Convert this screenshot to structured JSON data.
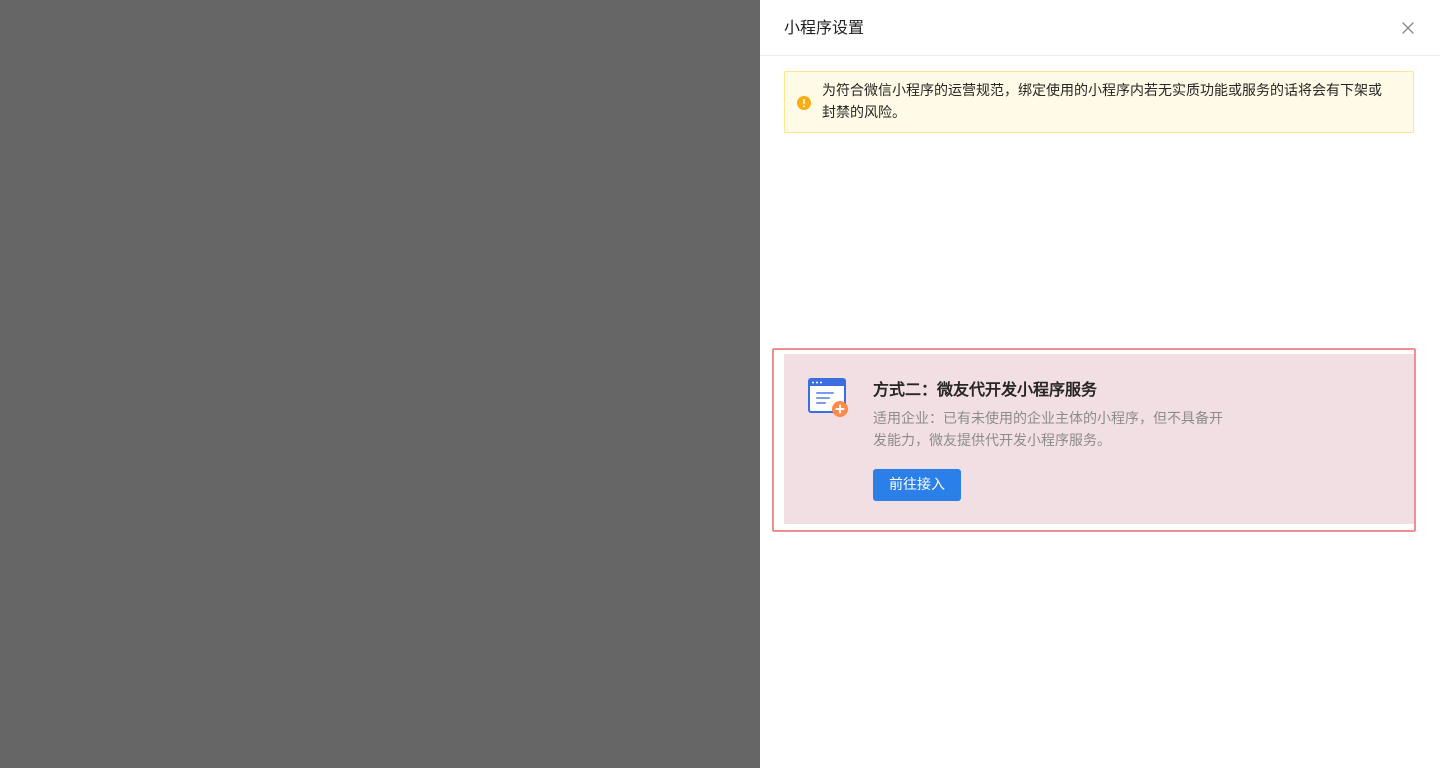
{
  "drawer": {
    "title": "小程序设置",
    "close_icon": "close-icon"
  },
  "alert": {
    "icon": "exclamation-circle-icon",
    "color": "#faad14",
    "text": "为符合微信小程序的运营规范，绑定使用的小程序内若无实质功能或服务的话将会有下架或封禁的风险。"
  },
  "card": {
    "icon": "mini-program-add-icon",
    "title": "方式二：微友代开发小程序服务",
    "description": "适用企业：已有未使用的企业主体的小程序，但不具备开发能力，微友提供代开发小程序服务。",
    "button_label": "前往接入",
    "accent_color": "#2b7fe8",
    "highlight_color": "#f08f93"
  }
}
